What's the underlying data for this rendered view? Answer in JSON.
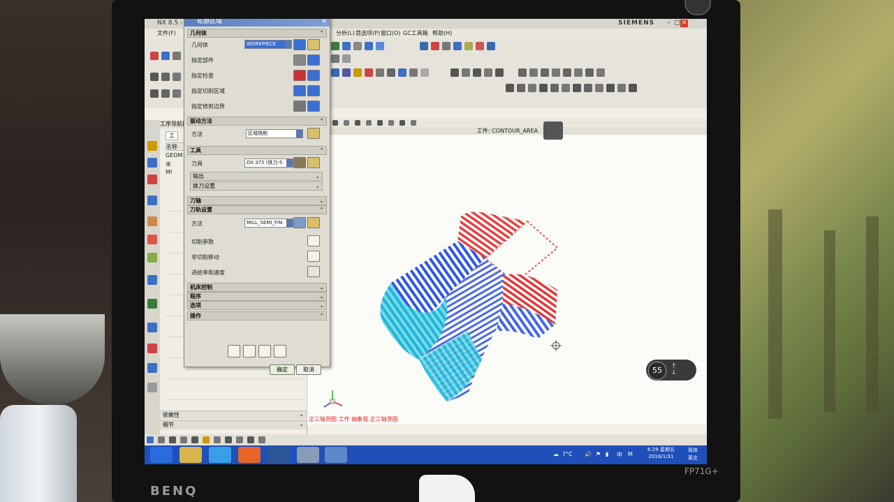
{
  "monitor": {
    "brand": "BENQ",
    "model": "FP71G+"
  },
  "app": {
    "window_title": "NX 8.5 -",
    "vendor": "SIEMENS",
    "menu": [
      "文件(F)",
      "分析(L)",
      "首选项(P)",
      "窗口(O)",
      "GC工具箱",
      "帮助(H)"
    ]
  },
  "dialog": {
    "title": "轮廓区域",
    "sections": {
      "geometry": "几何体",
      "drive": "驱动方法",
      "tool": "工具",
      "axis": "刀轴",
      "path": "刀轨设置",
      "machine": "机床控制",
      "program": "程序",
      "options": "选项",
      "actions": "操作"
    },
    "geometry_rows": {
      "geometry": "几何体",
      "geometry_value": "WORKPIECE",
      "part": "指定部件",
      "check": "指定检查",
      "cut_area": "指定切削区域",
      "trim": "指定修剪边界"
    },
    "drive_method": {
      "label": "方法",
      "value": "区域铣削"
    },
    "tool": {
      "label": "刀具",
      "value": "D0.375 (铣刀-5",
      "output": "输出",
      "change": "换刀设置"
    },
    "path": {
      "method_label": "方法",
      "method_value": "MILL_SEMI_FIN",
      "cut_params": "切削参数",
      "non_cut": "非切削移动",
      "feeds": "进给率和速度"
    },
    "ok": "确定",
    "cancel": "取消"
  },
  "navigator": {
    "header": "工序导航器",
    "tab": "工",
    "col_name": "名称",
    "rows": [
      "GEOM",
      "未",
      "MI"
    ],
    "footer1": "依赖性",
    "footer2": "细节"
  },
  "viewport": {
    "title": "工件: CONTOUR_AREA",
    "view_label": "正三轴测图 工作 抽象视 正三轴测图",
    "zoom": "55"
  },
  "taskbar": {
    "weather": "7°C",
    "ime": "中",
    "ime_mode": "M",
    "time": "6:29 星期五",
    "date": "2016/1/31",
    "ime_badge": "简体",
    "ime_badge2": "英文"
  }
}
